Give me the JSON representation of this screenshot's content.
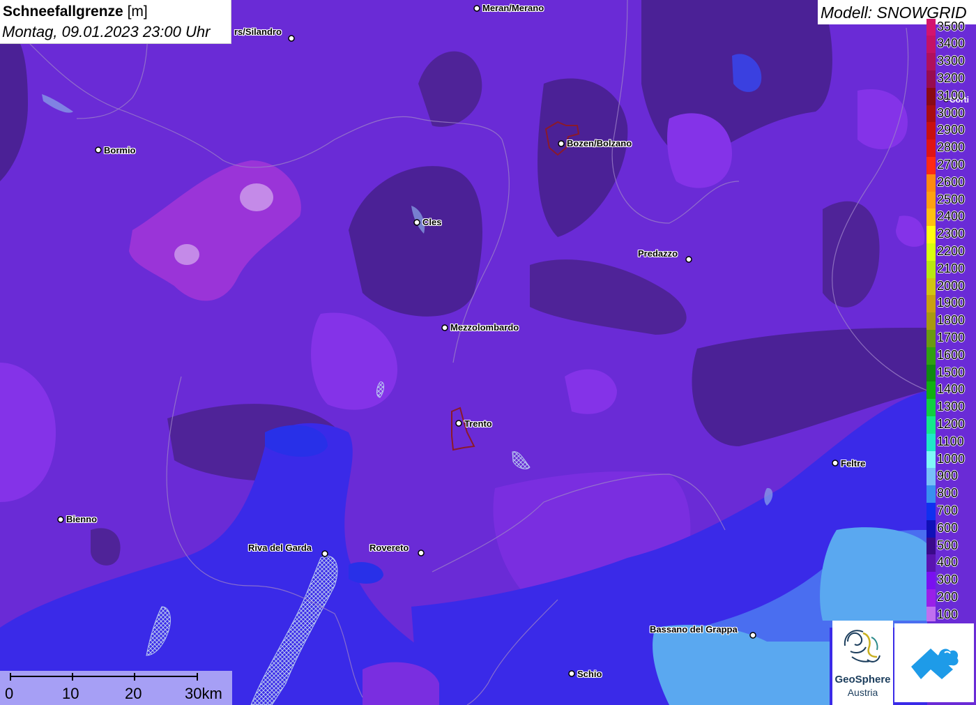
{
  "title": {
    "main": "Schneefallgrenze",
    "unit": "[m]",
    "datetime": "Montag, 09.01.2023 23:00 Uhr"
  },
  "model": {
    "label": "Modell: SNOWGRID"
  },
  "cities": [
    {
      "name": "Meran/Merano"
    },
    {
      "name": "rs/Silandro"
    },
    {
      "name": "Bormio"
    },
    {
      "name": "Bozen/Bolzano"
    },
    {
      "name": "Cles"
    },
    {
      "name": "Predazzo"
    },
    {
      "name": "Mezzolombardo"
    },
    {
      "name": "Trento"
    },
    {
      "name": "Feltre"
    },
    {
      "name": "Bienno"
    },
    {
      "name": "Riva del Garda"
    },
    {
      "name": "Rovereto"
    },
    {
      "name": "Bassano del Grappa"
    },
    {
      "name": "Schio"
    },
    {
      "name": "Corti"
    }
  ],
  "legend": {
    "items": [
      {
        "label": "3500",
        "color": "#d4146e"
      },
      {
        "label": "3400",
        "color": "#c41266"
      },
      {
        "label": "3300",
        "color": "#b0105c"
      },
      {
        "label": "3200",
        "color": "#980c50"
      },
      {
        "label": "3100",
        "color": "#8a0a14"
      },
      {
        "label": "3000",
        "color": "#a80c12"
      },
      {
        "label": "2900",
        "color": "#c81010"
      },
      {
        "label": "2800",
        "color": "#e01414"
      },
      {
        "label": "2700",
        "color": "#ff2a14"
      },
      {
        "label": "2600",
        "color": "#ff8a10"
      },
      {
        "label": "2500",
        "color": "#ffa010"
      },
      {
        "label": "2400",
        "color": "#ffc010"
      },
      {
        "label": "2300",
        "color": "#ffff10"
      },
      {
        "label": "2200",
        "color": "#d8ff10"
      },
      {
        "label": "2100",
        "color": "#b8e810"
      },
      {
        "label": "2000",
        "color": "#d0c410"
      },
      {
        "label": "1900",
        "color": "#c8a010"
      },
      {
        "label": "1800",
        "color": "#a89a10"
      },
      {
        "label": "1700",
        "color": "#6a9a10"
      },
      {
        "label": "1600",
        "color": "#30a010"
      },
      {
        "label": "1500",
        "color": "#108a10"
      },
      {
        "label": "1400",
        "color": "#10b010"
      },
      {
        "label": "1300",
        "color": "#10d040"
      },
      {
        "label": "1200",
        "color": "#14e88a"
      },
      {
        "label": "1100",
        "color": "#20e8c8"
      },
      {
        "label": "1000",
        "color": "#80f8f8"
      },
      {
        "label": "900",
        "color": "#78c0f8"
      },
      {
        "label": "800",
        "color": "#3890f0"
      },
      {
        "label": "700",
        "color": "#1030f0"
      },
      {
        "label": "600",
        "color": "#1010b8"
      },
      {
        "label": "500",
        "color": "#3a0a8a"
      },
      {
        "label": "400",
        "color": "#5a14b0"
      },
      {
        "label": "300",
        "color": "#7a10f0"
      },
      {
        "label": "200",
        "color": "#9a20e8"
      },
      {
        "label": "100",
        "color": "#c070f0"
      }
    ]
  },
  "scale": {
    "labels": [
      "0",
      "10",
      "20",
      "30km"
    ]
  },
  "logos": {
    "geosphere_line1": "GeoSphere",
    "geosphere_line2": "Austria"
  }
}
